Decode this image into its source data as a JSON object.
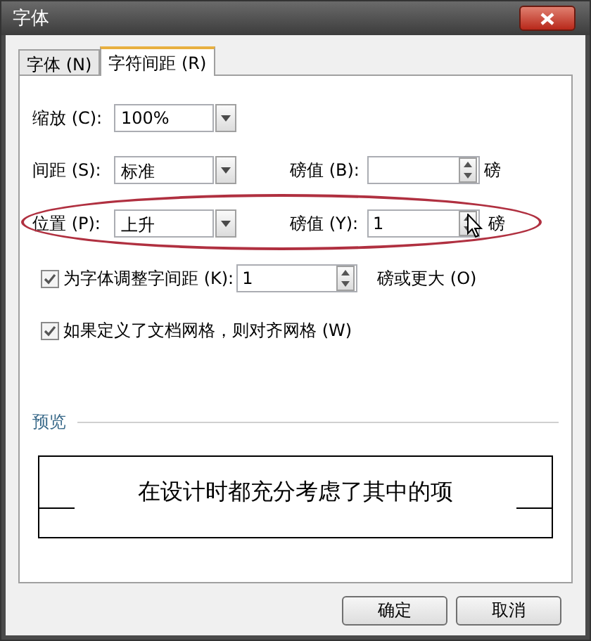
{
  "window": {
    "title": "字体"
  },
  "tabs": [
    {
      "label": "字体 (N)",
      "selected": false
    },
    {
      "label": "字符间距 (R)",
      "selected": true
    }
  ],
  "scale": {
    "label": "缩放 (C):",
    "value": "100%"
  },
  "spacing": {
    "label": "间距 (S):",
    "value": "标准",
    "points_label": "磅值 (B):",
    "unit": "磅"
  },
  "position": {
    "label": "位置 (P):",
    "value": "上升",
    "points_label": "磅值 (Y):",
    "points_value": "1",
    "unit": "磅"
  },
  "checkboxes": [
    {
      "label": "为字体调整字间距 (K):",
      "checked": true,
      "value": "1",
      "suffix": "磅或更大 (O)"
    },
    {
      "label": "如果定义了文档网格，则对齐网格 (W)",
      "checked": true
    }
  ],
  "preview": {
    "label": "预览",
    "sample": "在设计时都充分考虑了其中的项"
  },
  "buttons": [
    "确定",
    "取消"
  ]
}
